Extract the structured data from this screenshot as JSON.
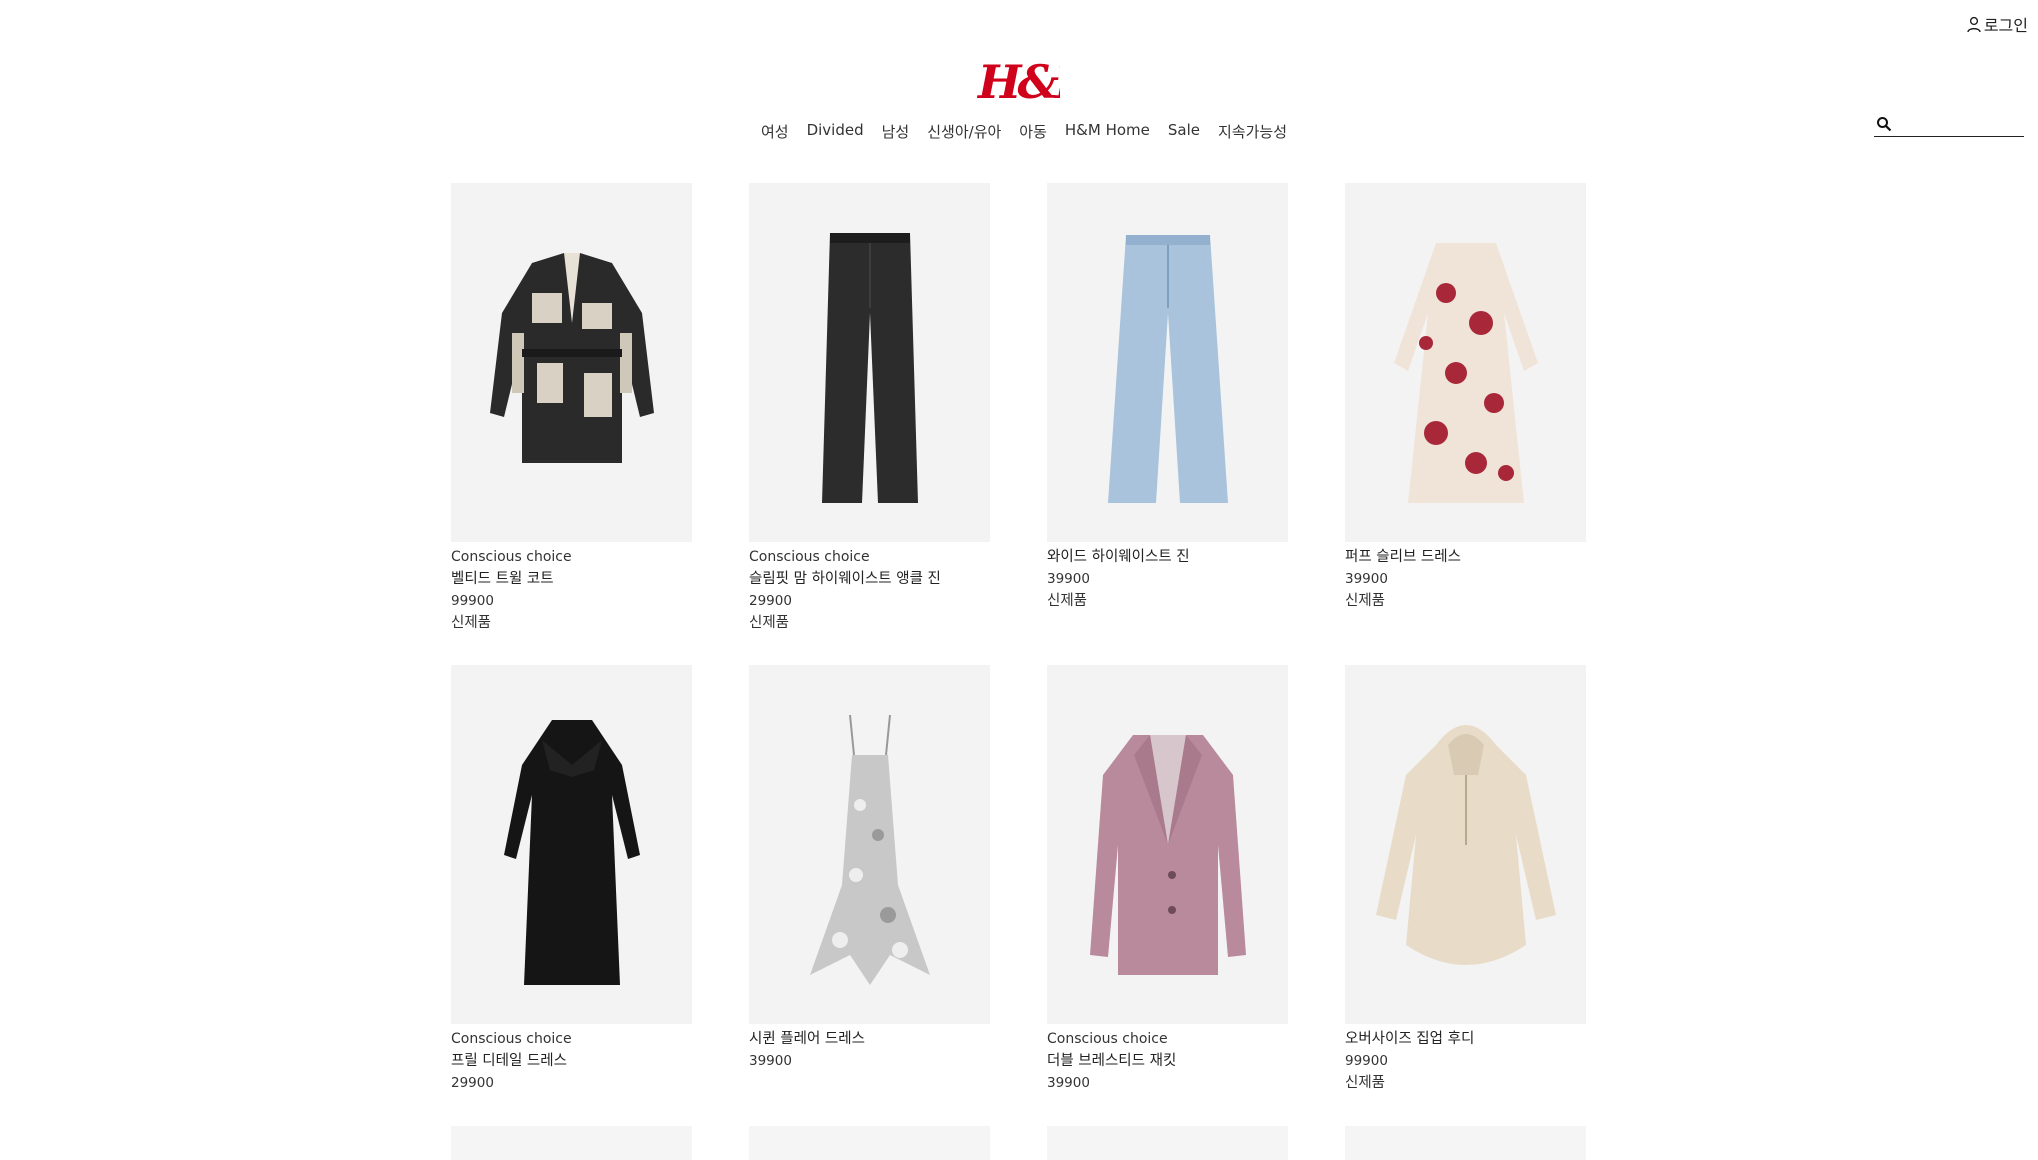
{
  "header": {
    "login_label": "로그인",
    "logo_text": "H&M",
    "brand_color": "#d0021b",
    "nav": [
      "여성",
      "Divided",
      "남성",
      "신생아/유아",
      "아동",
      "H&M Home",
      "Sale",
      "지속가능성"
    ],
    "search": {
      "placeholder": "",
      "value": ""
    }
  },
  "products": [
    {
      "tag": "Conscious choice",
      "name": "벨티드 트윌 코트",
      "price": "99900",
      "badge": "신제품",
      "icon": "patterned-jacket-image"
    },
    {
      "tag": "Conscious choice",
      "name": "슬림핏 맘 하이웨이스트 앵클 진",
      "price": "29900",
      "badge": "신제품",
      "icon": "black-jeans-image"
    },
    {
      "tag": "",
      "name": "와이드 하이웨이스트 진",
      "price": "39900",
      "badge": "신제품",
      "icon": "light-blue-jeans-image"
    },
    {
      "tag": "",
      "name": "퍼프 슬리브 드레스",
      "price": "39900",
      "badge": "신제품",
      "icon": "floral-dress-image"
    },
    {
      "tag": "Conscious choice",
      "name": "프릴 디테일 드레스",
      "price": "29900",
      "badge": "",
      "icon": "black-dress-image"
    },
    {
      "tag": "",
      "name": "시퀸 플레어 드레스",
      "price": "39900",
      "badge": "",
      "icon": "sequin-dress-image"
    },
    {
      "tag": "Conscious choice",
      "name": "더블 브레스티드 재킷",
      "price": "39900",
      "badge": "",
      "icon": "pink-blazer-image"
    },
    {
      "tag": "",
      "name": "오버사이즈 집업 후디",
      "price": "99900",
      "badge": "신제품",
      "icon": "beige-hoodie-image"
    }
  ]
}
